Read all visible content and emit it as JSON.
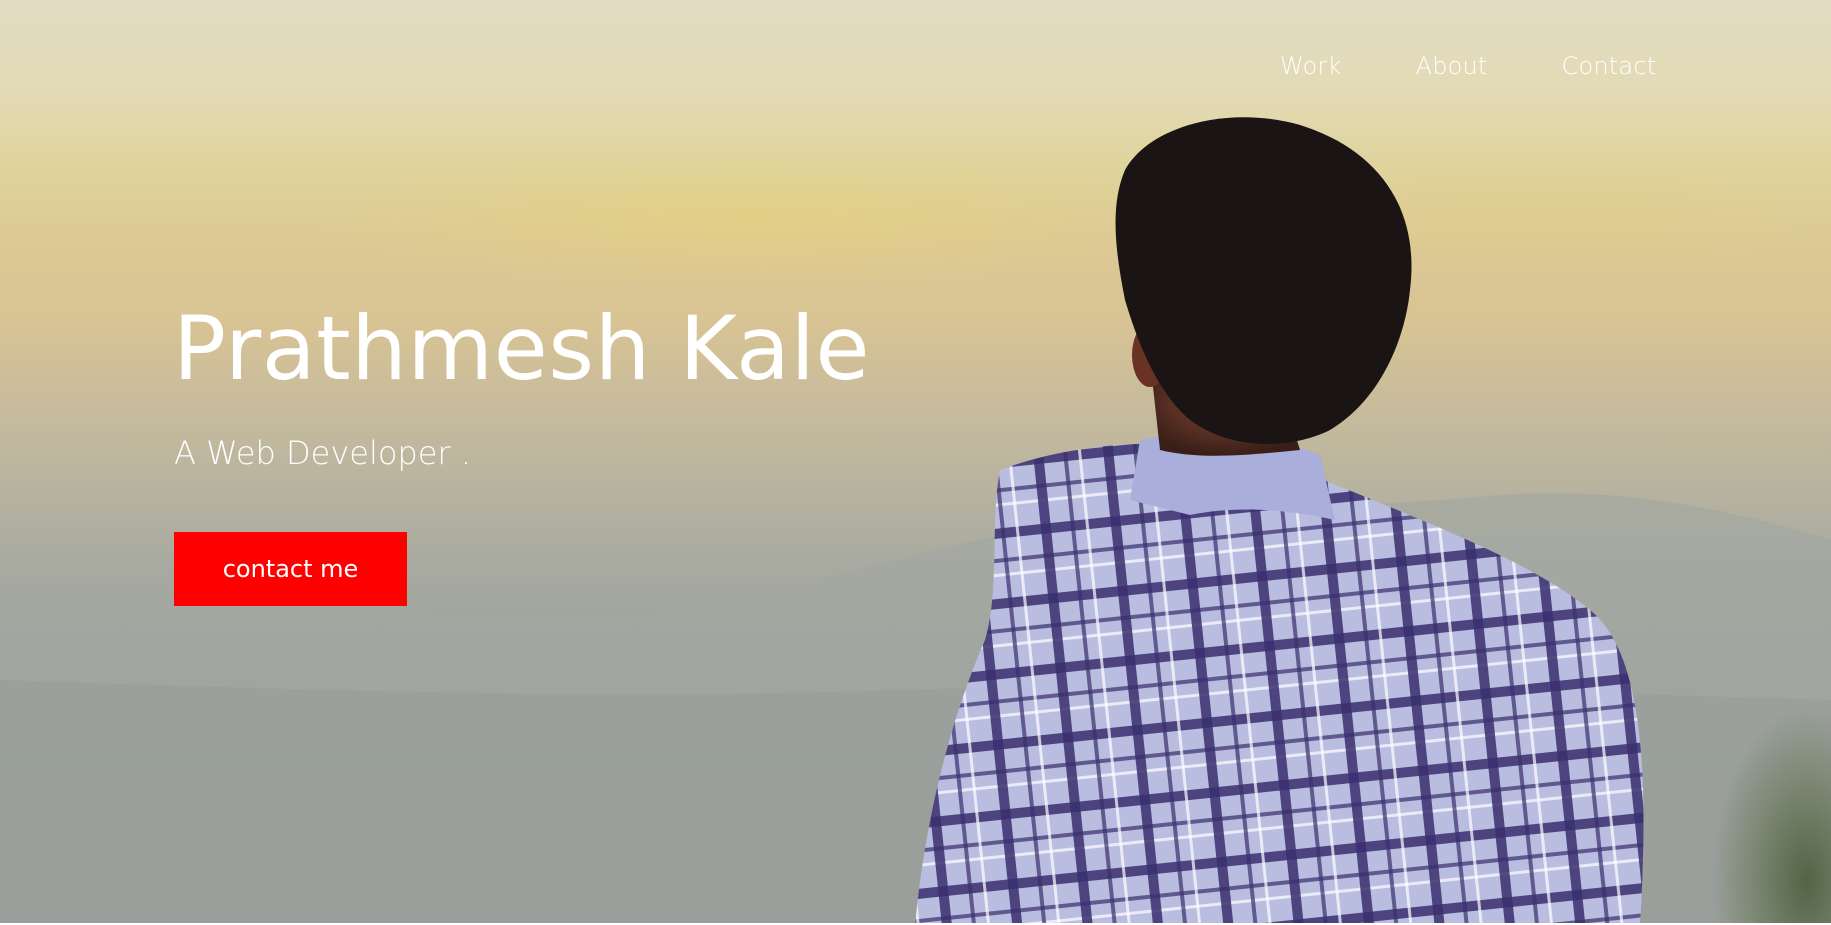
{
  "nav": {
    "items": [
      {
        "label": "Work"
      },
      {
        "label": "About"
      },
      {
        "label": "Contact"
      }
    ]
  },
  "hero": {
    "name": "Prathmesh Kale",
    "subtitle": "A Web Developer .",
    "cta_label": "contact me"
  },
  "colors": {
    "accent": "#ff0000",
    "text": "#ffffff",
    "sky_top": "#e2dcc3",
    "sky_glow": "#dfd49c",
    "haze": "#9aa09d"
  }
}
